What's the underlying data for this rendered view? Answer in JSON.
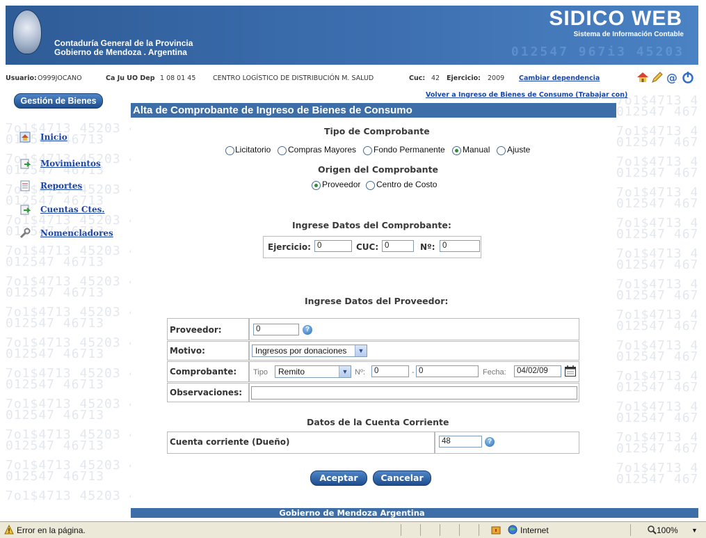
{
  "header": {
    "org_line1": "Contaduría General de la Provincia",
    "org_line2": "Gobierno de Mendoza . Argentina",
    "brand": "SIDICO WEB",
    "brand_subtitle": "Sistema de Información Contable",
    "decoration_digits": "012547  967i3 45203"
  },
  "infobar": {
    "usuario_label": "Usuario:",
    "usuario_value": "O999JOCANO",
    "dep_label": "Ca Ju UO Dep",
    "dep_value": "1 08 01 45",
    "dep_name": "CENTRO LOGÍSTICO DE DISTRIBUCIÓN M. SALUD",
    "cuc_label": "Cuc:",
    "cuc_value": "42",
    "ejercicio_label": "Ejercicio:",
    "ejercicio_value": "2009",
    "cambiar_link": "Cambiar dependencia"
  },
  "watermark": [
    "7o1$4713 45203 4",
    "012547 46713",
    "7o1$4713 45203 4",
    "012547 46713"
  ],
  "sidebar": {
    "title": "Gestión de Bienes",
    "items": [
      {
        "label": "Inicio",
        "icon": "home-icon"
      },
      {
        "label": "Movimientos",
        "icon": "movements-icon"
      },
      {
        "label": "Reportes",
        "icon": "reports-icon"
      },
      {
        "label": "Cuentas Ctes.",
        "icon": "accounts-icon"
      },
      {
        "label": "Nomencladores",
        "icon": "wrench-icon"
      }
    ]
  },
  "main": {
    "back_link": "Volver a Ingreso de Bienes de Consumo (Trabajar con)",
    "title": "Alta de Comprobante de Ingreso de Bienes de Consumo",
    "tipo_title": "Tipo de Comprobante",
    "tipo_options": [
      {
        "label": "Licitatorio",
        "selected": false
      },
      {
        "label": "Compras Mayores",
        "selected": false
      },
      {
        "label": "Fondo Permanente",
        "selected": false
      },
      {
        "label": "Manual",
        "selected": true
      },
      {
        "label": "Ajuste",
        "selected": false
      }
    ],
    "origen_title": "Origen del Comprobante",
    "origen_options": [
      {
        "label": "Proveedor",
        "selected": true
      },
      {
        "label": "Centro de Costo",
        "selected": false
      }
    ],
    "datos_comprobante_title": "Ingrese Datos del Comprobante:",
    "ejercicio_label": "Ejercicio:",
    "ejercicio_value": "0",
    "cuc_label": "CUC:",
    "cuc_value": "0",
    "numero_label": "Nº:",
    "numero_value": "0",
    "datos_proveedor_title": "Ingrese Datos del Proveedor:",
    "proveedor_label": "Proveedor:",
    "proveedor_value": "0",
    "motivo_label": "Motivo:",
    "motivo_value": "Ingresos por donaciones",
    "comprobante_label": "Comprobante:",
    "tipo_small_label": "Tipo",
    "tipo_value": "Remito",
    "nro_small_label": "Nº:",
    "nro_value1": "0",
    "dash": "-",
    "nro_value2": "0",
    "fecha_label": "Fecha:",
    "fecha_value": "04/02/09",
    "observaciones_label": "Observaciones:",
    "observaciones_value": "",
    "cuenta_title": "Datos de la Cuenta Corriente",
    "cuenta_label": "Cuenta corriente (Dueño)",
    "cuenta_value": "48",
    "aceptar": "Aceptar",
    "cancelar": "Cancelar"
  },
  "footer": "Gobierno de Mendoza Argentina",
  "statusbar": {
    "error_text": "Error en la página.",
    "zone": "Internet",
    "zoom": "100%"
  }
}
